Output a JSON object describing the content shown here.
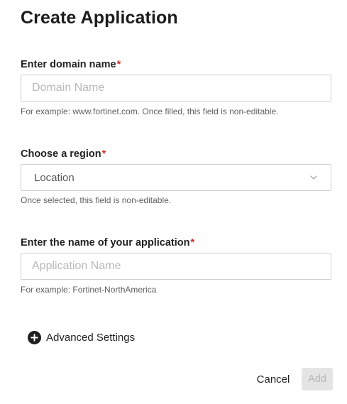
{
  "dialog": {
    "title": "Create Application"
  },
  "domain_field": {
    "label": "Enter domain name",
    "required_mark": "*",
    "placeholder": "Domain Name",
    "value": "",
    "helper": "For example: www.fortinet.com. Once filled, this field is non-editable."
  },
  "region_field": {
    "label": "Choose a region",
    "required_mark": "*",
    "selected": "Location",
    "helper": "Once selected, this field is non-editable.",
    "icon": "chevron-down-icon"
  },
  "app_name_field": {
    "label": "Enter the name of your application",
    "required_mark": "*",
    "placeholder": "Application Name",
    "value": "",
    "helper": "For example: Fortinet-NorthAmerica"
  },
  "advanced": {
    "label": "Advanced Settings",
    "icon": "plus-circle-icon"
  },
  "footer": {
    "cancel_label": "Cancel",
    "add_label": "Add",
    "add_disabled": true
  },
  "colors": {
    "required": "#d0302d",
    "disabled_button_bg": "#e4e4e4",
    "disabled_button_text": "#b8b8b8",
    "border": "#cfcfcf"
  }
}
